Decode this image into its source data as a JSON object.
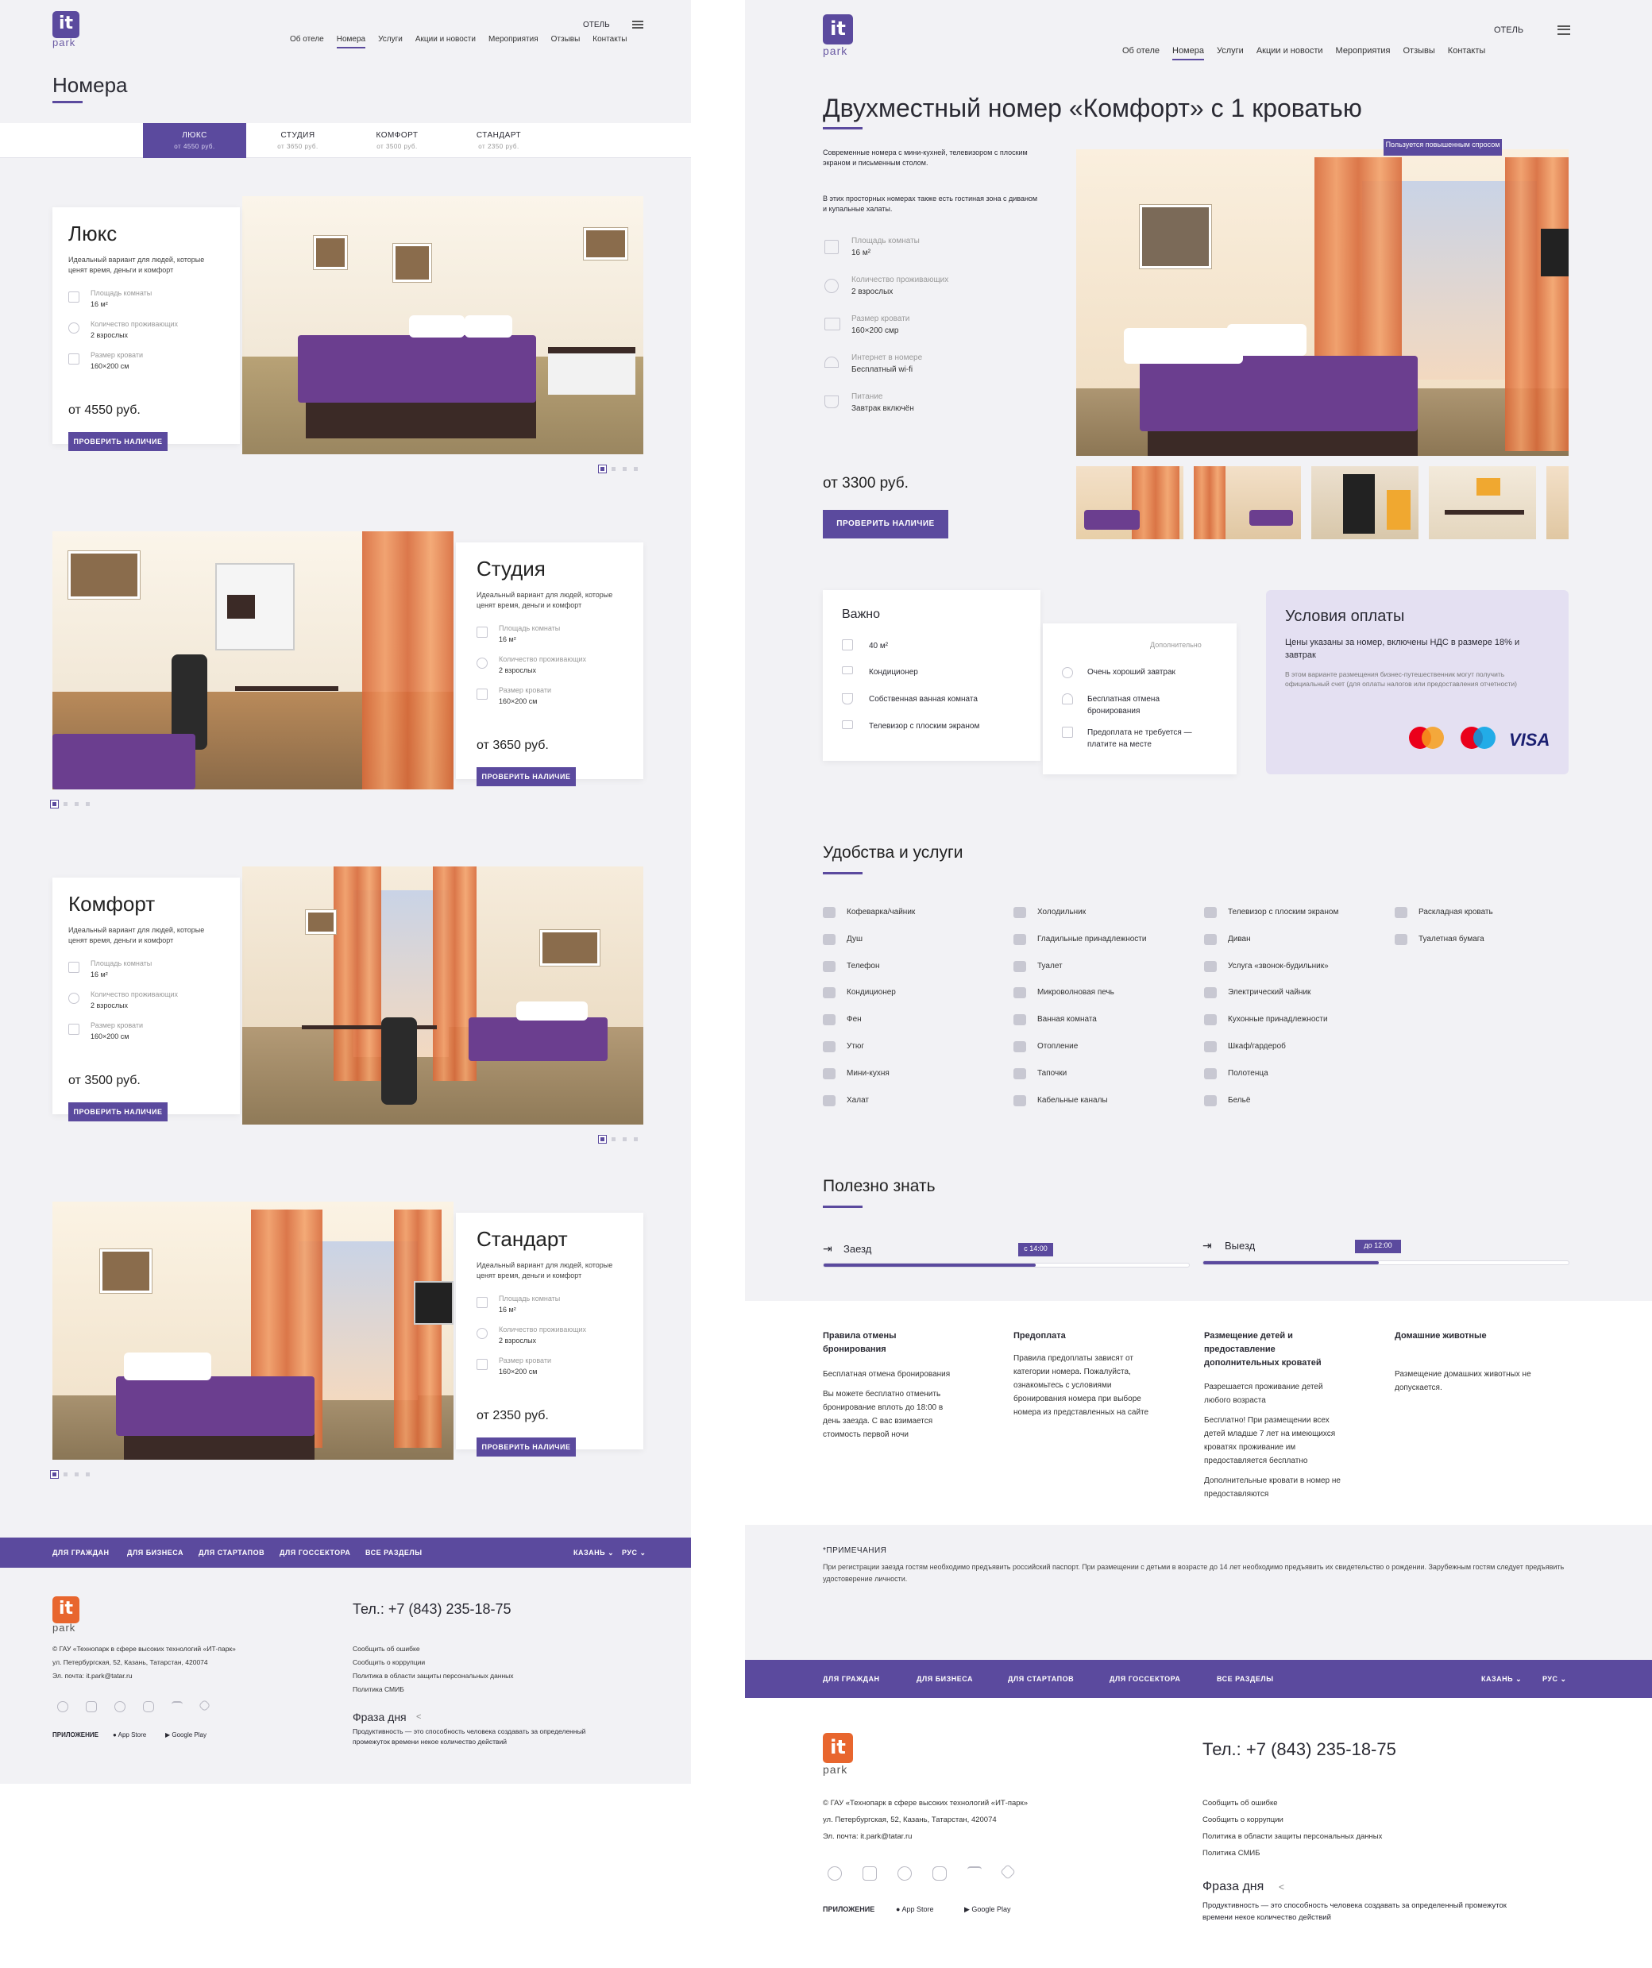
{
  "left": {
    "logo": {
      "mark": "it",
      "name": "park"
    },
    "hotel_label": "ОТЕЛЬ",
    "nav": [
      "Об отеле",
      "Номера",
      "Услуги",
      "Акции и новости",
      "Мероприятия",
      "Отзывы",
      "Контакты"
    ],
    "title": "Номера",
    "tabs": [
      {
        "label": "ЛЮКС",
        "price": "от 4550 руб."
      },
      {
        "label": "СТУДИЯ",
        "price": "от 3650 руб."
      },
      {
        "label": "КОМФОРТ",
        "price": "от 3500 руб."
      },
      {
        "label": "СТАНДАРТ",
        "price": "от 2350 руб."
      }
    ],
    "rooms": [
      {
        "name": "Люкс",
        "desc": "Идеальный вариант для людей, которые ценят время, деньги и комфорт",
        "f1l": "Площадь комнаты",
        "f1v": "16 м²",
        "f2l": "Количество проживающих",
        "f2v": "2 взрослых",
        "f3l": "Размер кровати",
        "f3v": "160×200 см",
        "price": "от 4550 руб.",
        "btn": "ПРОВЕРИТЬ НАЛИЧИЕ"
      },
      {
        "name": "Студия",
        "desc": "Идеальный вариант для людей, которые ценят время, деньги и комфорт",
        "f1l": "Площадь комнаты",
        "f1v": "16 м²",
        "f2l": "Количество проживающих",
        "f2v": "2 взрослых",
        "f3l": "Размер кровати",
        "f3v": "160×200 см",
        "price": "от 3650 руб.",
        "btn": "ПРОВЕРИТЬ НАЛИЧИЕ"
      },
      {
        "name": "Комфорт",
        "desc": "Идеальный вариант для людей, которые ценят время, деньги и комфорт",
        "f1l": "Площадь комнаты",
        "f1v": "16 м²",
        "f2l": "Количество проживающих",
        "f2v": "2 взрослых",
        "f3l": "Размер кровати",
        "f3v": "160×200 см",
        "price": "от 3500 руб.",
        "btn": "ПРОВЕРИТЬ НАЛИЧИЕ"
      },
      {
        "name": "Стандарт",
        "desc": "Идеальный вариант для людей, которые ценят время, деньги и комфорт",
        "f1l": "Площадь комнаты",
        "f1v": "16 м²",
        "f2l": "Количество проживающих",
        "f2v": "2 взрослых",
        "f3l": "Размер кровати",
        "f3v": "160×200 см",
        "price": "от 2350 руб.",
        "btn": "ПРОВЕРИТЬ НАЛИЧИЕ"
      }
    ],
    "footer_nav": [
      "ДЛЯ ГРАЖДАН",
      "ДЛЯ БИЗНЕСА",
      "ДЛЯ СТАРТАПОВ",
      "ДЛЯ ГОССЕКТОРА",
      "ВСЕ РАЗДЕЛЫ"
    ],
    "city": "КАЗАНЬ ⌄",
    "lang": "РУС ⌄",
    "phone": "Тел.: +7 (843) 235-18-75",
    "org": [
      "© ГАУ «Технопарк в сфере высоких технологий «ИТ-парк»",
      "ул. Петербургская, 52, Казань, Татарстан, 420074",
      "Эл. почта: it.park@tatar.ru"
    ],
    "links": [
      "Сообщить об ошибке",
      "Сообщить о коррупции",
      "Политика в области защиты персональных данных",
      "Политика СМИБ"
    ],
    "phrase_title": "Фраза дня",
    "phrase": "Продуктивность — это способность человека создавать за определенный промежуток времени некое количество действий",
    "app_label": "ПРИЛОЖЕНИЕ",
    "app_store": "App Store",
    "google_play": "Google Play"
  },
  "right": {
    "title": "Двухместный номер «Комфорт» с 1 кроватью",
    "intro1": "Современные номера с мини-кухней, телевизором с плоским экраном и письменным столом.",
    "intro2": "В этих просторных номерах также есть гостиная зона с диваном и купальные халаты.",
    "features": [
      {
        "l": "Площадь комнаты",
        "v": "16 м²"
      },
      {
        "l": "Количество проживающих",
        "v": "2 взрослых"
      },
      {
        "l": "Размер кровати",
        "v": "160×200 смр"
      },
      {
        "l": "Интернет в номере",
        "v": "Бесплатный wi-fi"
      },
      {
        "l": "Питание",
        "v": "Завтрак включён"
      }
    ],
    "price": "от 3300 руб.",
    "btn": "ПРОВЕРИТЬ НАЛИЧИЕ",
    "demand": "Пользуется повышенным спросом",
    "important_title": "Важно",
    "important": [
      "40 м²",
      "Кондиционер",
      "Собственная ванная комната",
      "Телевизор с плоским экраном"
    ],
    "extra_label": "Дополнительно",
    "extra": [
      "Очень хороший завтрак",
      "Бесплатная отмена бронирования",
      "Предоплата не требуется — платите на месте"
    ],
    "pay_title": "Условия оплаты",
    "pay_text": "Цены указаны за номер, включены НДС в размере 18% и завтрак",
    "pay_small": "В этом варианте размещения бизнес-путешественник могут получить официальный счет (для оплаты налогов или предоставления отчетности)",
    "cards": [
      "mastercard",
      "maestro",
      "VISA"
    ],
    "amen_title": "Удобства и услуги",
    "amenities": [
      [
        "Кофеварка/чайник",
        "Душ",
        "Телефон",
        "Кондиционер",
        "Фен",
        "Утюг",
        "Мини-кухня",
        "Халат"
      ],
      [
        "Холодильник",
        "Гладильные принадлежности",
        "Туалет",
        "Микроволновая печь",
        "Ванная комната",
        "Отопление",
        "Тапочки",
        "Кабельные каналы"
      ],
      [
        "Телевизор с плоским экраном",
        "Диван",
        "Услуга «звонок-будильник»",
        "Электрический чайник",
        "Кухонные принадлежности",
        "Шкаф/гардероб",
        "Полотенца",
        "Бельё"
      ],
      [
        "Раскладная кровать",
        "Туалетная бумага"
      ]
    ],
    "useful_title": "Полезно знать",
    "checkin": "Заезд",
    "checkin_time": "с 14:00",
    "checkin_fill": 0.58,
    "checkout": "Выезд",
    "checkout_time": "до 12:00",
    "checkout_fill": 0.48,
    "rules": [
      {
        "h": "Правила отмены бронирования",
        "p": [
          "Бесплатная отмена бронирования",
          "Вы можете бесплатно отменить бронирование вплоть до 18:00 в день заезда. С вас взимается стоимость первой ночи"
        ]
      },
      {
        "h": "Предоплата",
        "p": [
          "Правила предоплаты зависят от категории номера. Пожалуйста, ознакомьтесь с условиями бронирования номера при выборе номера из представленных на сайте"
        ]
      },
      {
        "h": "Размещение детей и предоставление дополнительных кроватей",
        "p": [
          "Разрешается проживание детей любого возраста",
          "Бесплатно! При размещении всех детей младше 7 лет на имеющихся кроватях проживание им предоставляется бесплатно",
          "Дополнительные кровати в номер не предоставляются"
        ]
      },
      {
        "h": "Домашние животные",
        "p": [
          "Размещение домашних животных не допускается."
        ]
      }
    ],
    "notes_title": "*ПРИМЕЧАНИЯ",
    "notes": "При регистрации заезда гостям необходимо предъявить российский паспорт. При размещении с детьми в возрасте до 14 лет необходимо предъявить их свидетельство о рождении. Зарубежным гостям следует предъявить удостоверение личности."
  }
}
